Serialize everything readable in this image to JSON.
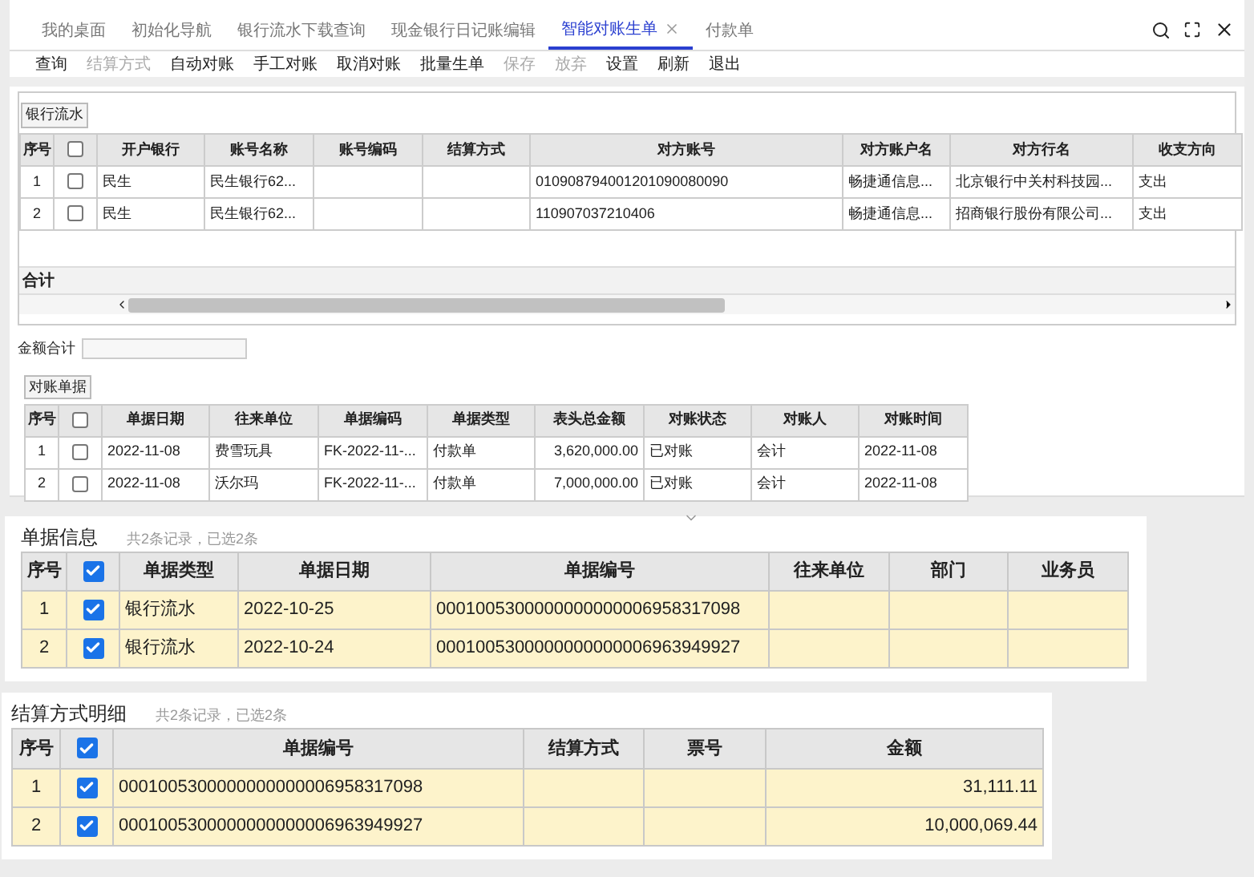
{
  "tabs": [
    {
      "label": "我的桌面",
      "selected": false,
      "closable": false
    },
    {
      "label": "初始化导航",
      "selected": false,
      "closable": false
    },
    {
      "label": "银行流水下载查询",
      "selected": false,
      "closable": false
    },
    {
      "label": "现金银行日记账编辑",
      "selected": false,
      "closable": false
    },
    {
      "label": "智能对账生单",
      "selected": true,
      "closable": true
    },
    {
      "label": "付款单",
      "selected": false,
      "closable": false
    }
  ],
  "toolbar": [
    {
      "label": "查询",
      "disabled": false
    },
    {
      "label": "结算方式",
      "disabled": true
    },
    {
      "label": "自动对账",
      "disabled": false
    },
    {
      "label": "手工对账",
      "disabled": false
    },
    {
      "label": "取消对账",
      "disabled": false
    },
    {
      "label": "批量生单",
      "disabled": false
    },
    {
      "label": "保存",
      "disabled": true
    },
    {
      "label": "放弃",
      "disabled": true
    },
    {
      "label": "设置",
      "disabled": false
    },
    {
      "label": "刷新",
      "disabled": false
    },
    {
      "label": "退出",
      "disabled": false
    }
  ],
  "bank_flow": {
    "label": "银行流水",
    "columns": [
      "序号",
      "开户银行",
      "账号名称",
      "账号编码",
      "结算方式",
      "对方账号",
      "对方账户名",
      "对方行名",
      "收支方向"
    ],
    "header_checked": false,
    "rows": [
      {
        "checked": false,
        "cells": [
          "1",
          "民生",
          "民生银行62...",
          "",
          "",
          "010908794001201090080090",
          "畅捷通信息...",
          "北京银行中关村科技园...",
          "支出"
        ]
      },
      {
        "checked": false,
        "cells": [
          "2",
          "民生",
          "民生银行62...",
          "",
          "",
          "110907037210406",
          "畅捷通信息...",
          "招商银行股份有限公司...",
          "支出"
        ]
      }
    ],
    "total_label": "合计"
  },
  "amount_total": {
    "label": "金额合计"
  },
  "reconciliation": {
    "label": "对账单据",
    "columns": [
      "序号",
      "单据日期",
      "往来单位",
      "单据编码",
      "单据类型",
      "表头总金额",
      "对账状态",
      "对账人",
      "对账时间"
    ],
    "header_checked": false,
    "rows": [
      {
        "checked": false,
        "cells": [
          "1",
          "2022-11-08",
          "费雪玩具",
          "FK-2022-11-...",
          "付款单",
          "3,620,000.00",
          "已对账",
          "会计",
          "2022-11-08"
        ]
      },
      {
        "checked": false,
        "cells": [
          "2",
          "2022-11-08",
          "沃尔玛",
          "FK-2022-11-...",
          "付款单",
          "7,000,000.00",
          "已对账",
          "会计",
          "2022-11-08"
        ]
      }
    ]
  },
  "document_info": {
    "title": "单据信息",
    "summary": "共2条记录，已选2条",
    "columns": [
      "序号",
      "单据类型",
      "单据日期",
      "单据编号",
      "往来单位",
      "部门",
      "业务员"
    ],
    "header_checked": true,
    "rows": [
      {
        "checked": true,
        "cells": [
          "1",
          "银行流水",
          "2022-10-25",
          "0001005300000000000006958317098",
          "",
          "",
          ""
        ]
      },
      {
        "checked": true,
        "cells": [
          "2",
          "银行流水",
          "2022-10-24",
          "0001005300000000000006963949927",
          "",
          "",
          ""
        ]
      }
    ]
  },
  "settlement_detail": {
    "title": "结算方式明细",
    "summary": "共2条记录，已选2条",
    "columns": [
      "序号",
      "单据编号",
      "结算方式",
      "票号",
      "金额"
    ],
    "header_checked": true,
    "rows": [
      {
        "checked": true,
        "cells": [
          "1",
          "0001005300000000000006958317098",
          "",
          "",
          "31,111.11"
        ]
      },
      {
        "checked": true,
        "cells": [
          "2",
          "0001005300000000000006963949927",
          "",
          "",
          "10,000,069.44"
        ]
      }
    ]
  }
}
